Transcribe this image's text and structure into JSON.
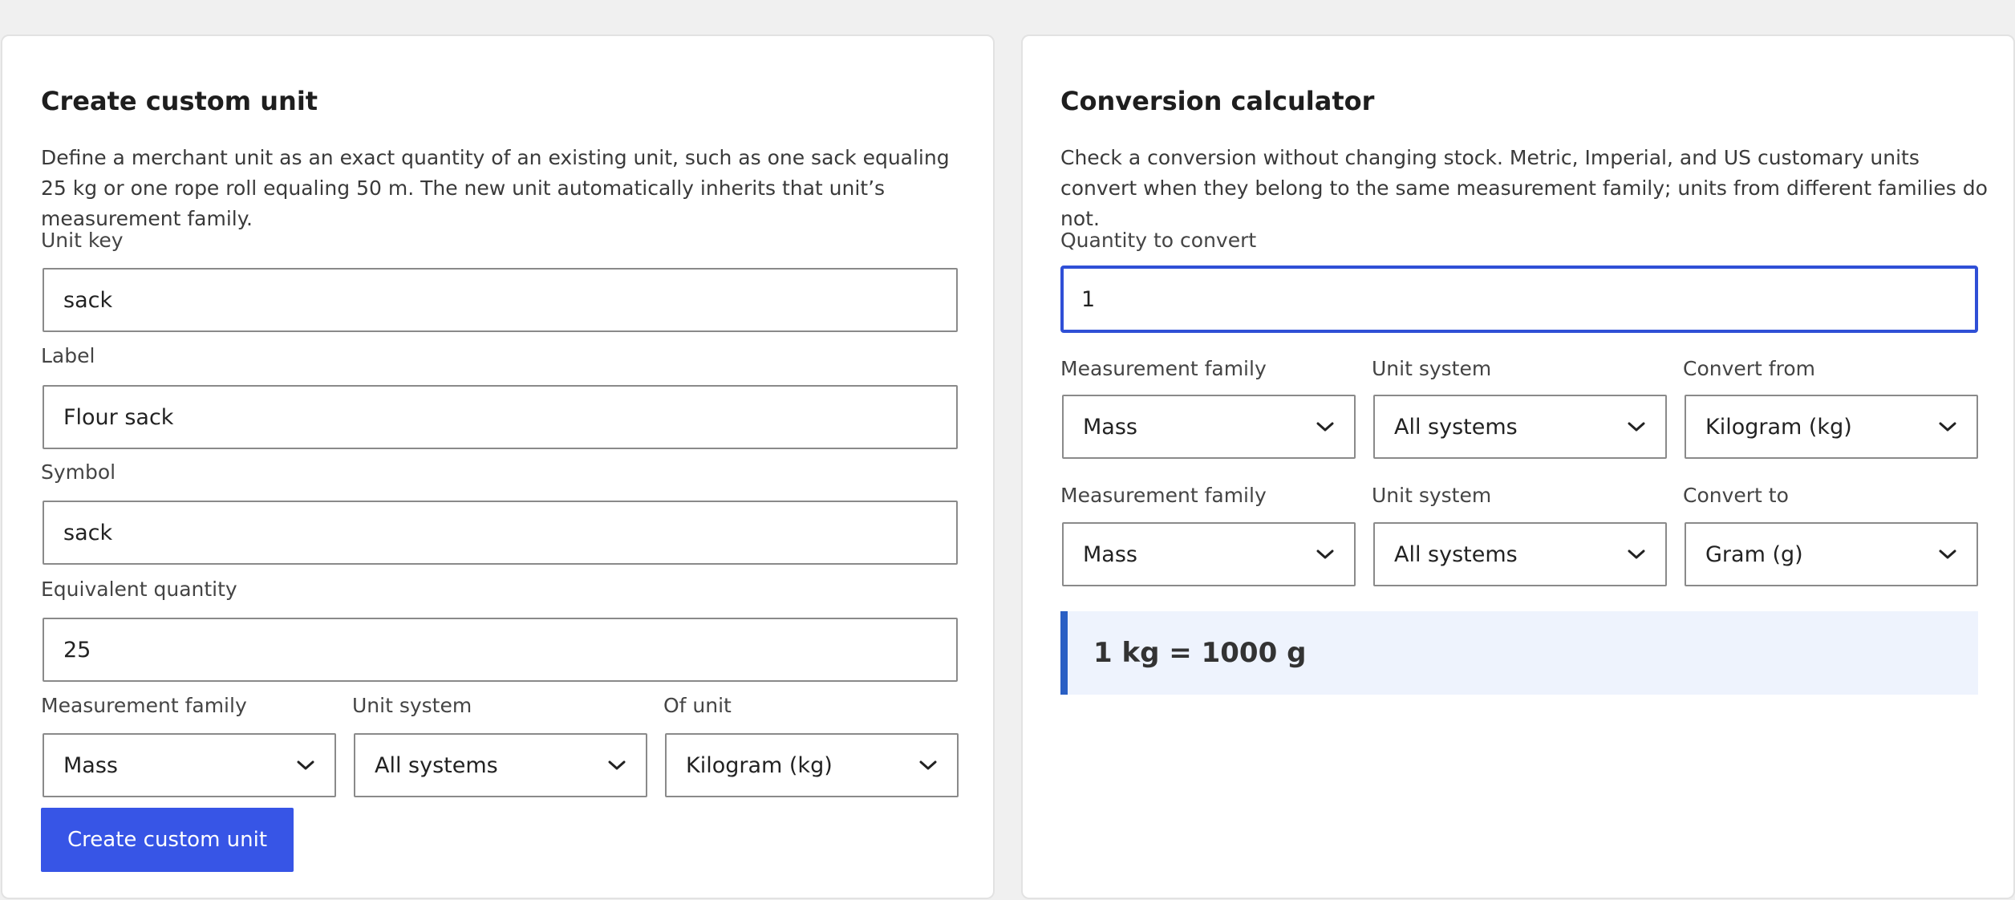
{
  "create": {
    "title": "Create custom unit",
    "description": "Define a merchant unit as an exact quantity of an existing unit, such as one sack equaling 25 kg or one rope roll equaling 50 m. The new unit automatically inherits that unit’s measurement family.",
    "unit_key": {
      "label": "Unit key",
      "value": "sack"
    },
    "label_field": {
      "label": "Label",
      "value": "Flour sack"
    },
    "symbol": {
      "label": "Symbol",
      "value": "sack"
    },
    "equivalent_quantity": {
      "label": "Equivalent quantity",
      "value": "25"
    },
    "measurement_family": {
      "label": "Measurement family",
      "value": "Mass"
    },
    "unit_system": {
      "label": "Unit system",
      "value": "All systems"
    },
    "of_unit": {
      "label": "Of unit",
      "value": "Kilogram (kg)"
    },
    "submit_label": "Create custom unit"
  },
  "calculator": {
    "title": "Conversion calculator",
    "description": "Check a conversion without changing stock. Metric, Imperial, and US customary units convert when they belong to the same measurement family; units from different families do not.",
    "quantity": {
      "label": "Quantity to convert",
      "value": "1"
    },
    "from": {
      "family": {
        "label": "Measurement family",
        "value": "Mass"
      },
      "system": {
        "label": "Unit system",
        "value": "All systems"
      },
      "unit": {
        "label": "Convert from",
        "value": "Kilogram (kg)"
      }
    },
    "to": {
      "family": {
        "label": "Measurement family",
        "value": "Mass"
      },
      "system": {
        "label": "Unit system",
        "value": "All systems"
      },
      "unit": {
        "label": "Convert to",
        "value": "Gram (g)"
      }
    },
    "result": "1 kg = 1000 g"
  },
  "colors": {
    "page_background": "#f0f0f0",
    "primary_button": "#3755e6",
    "focus_border": "#2f4fd6",
    "result_background": "#eef3fd",
    "result_accent": "#2a5fc4"
  },
  "icons": {
    "dropdown": "chevron-down-icon"
  }
}
